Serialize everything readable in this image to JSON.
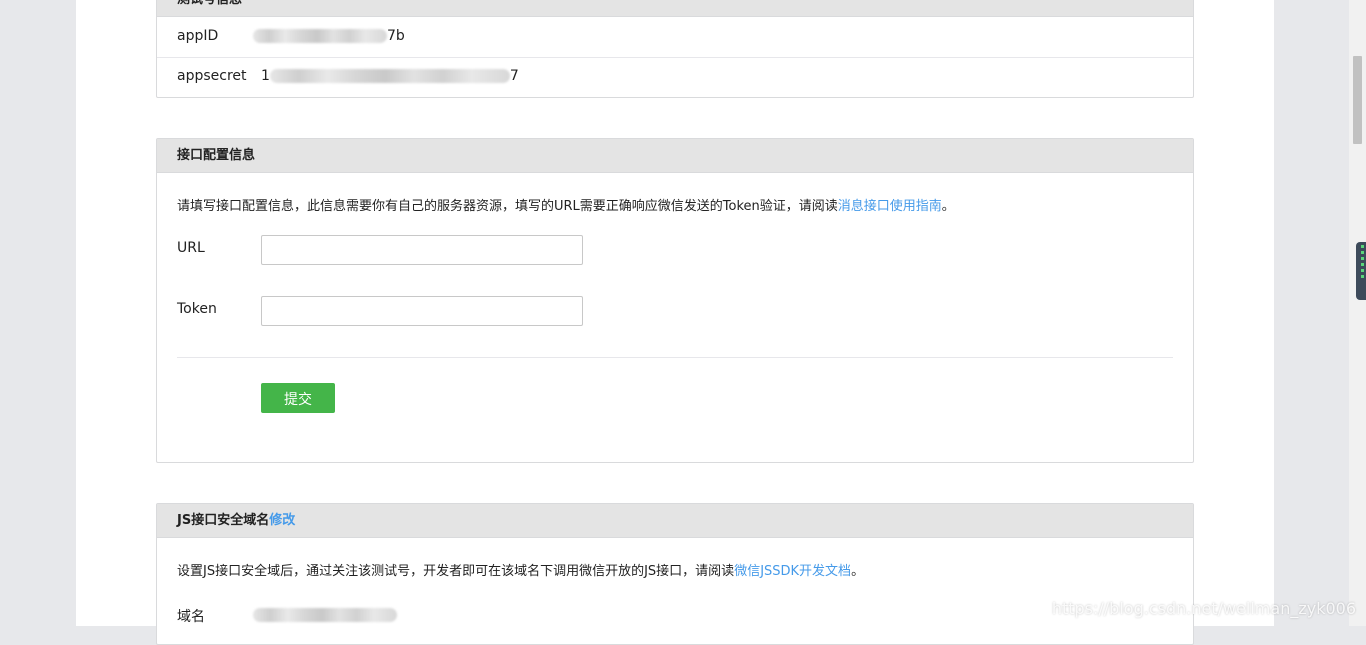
{
  "test_account": {
    "title": "测试号信息",
    "appid_label": "appID",
    "appid_suffix": "7b",
    "appsecret_label": "appsecret",
    "appsecret_prefix": "1",
    "appsecret_suffix": "7"
  },
  "interface_config": {
    "title": "接口配置信息",
    "desc_text": "请填写接口配置信息，此信息需要你有自己的服务器资源，填写的URL需要正确响应微信发送的Token验证，请阅读",
    "desc_link": "消息接口使用指南",
    "desc_end": "。",
    "url_label": "URL",
    "url_value": "",
    "token_label": "Token",
    "token_value": "",
    "submit_label": "提交"
  },
  "js_domain": {
    "title": "JS接口安全域名",
    "edit_link": "修改",
    "desc_text": "设置JS接口安全域后，通过关注该测试号，开发者即可在该域名下调用微信开放的JS接口，请阅读",
    "desc_link": "微信JSSDK开发文档",
    "desc_end": "。",
    "domain_label": "域名"
  },
  "watermark": "https://blog.csdn.net/wellman_zyk006",
  "colors": {
    "accent_green": "#44b549",
    "link_blue": "#459ae9",
    "panel_header": "#e4e4e4"
  }
}
